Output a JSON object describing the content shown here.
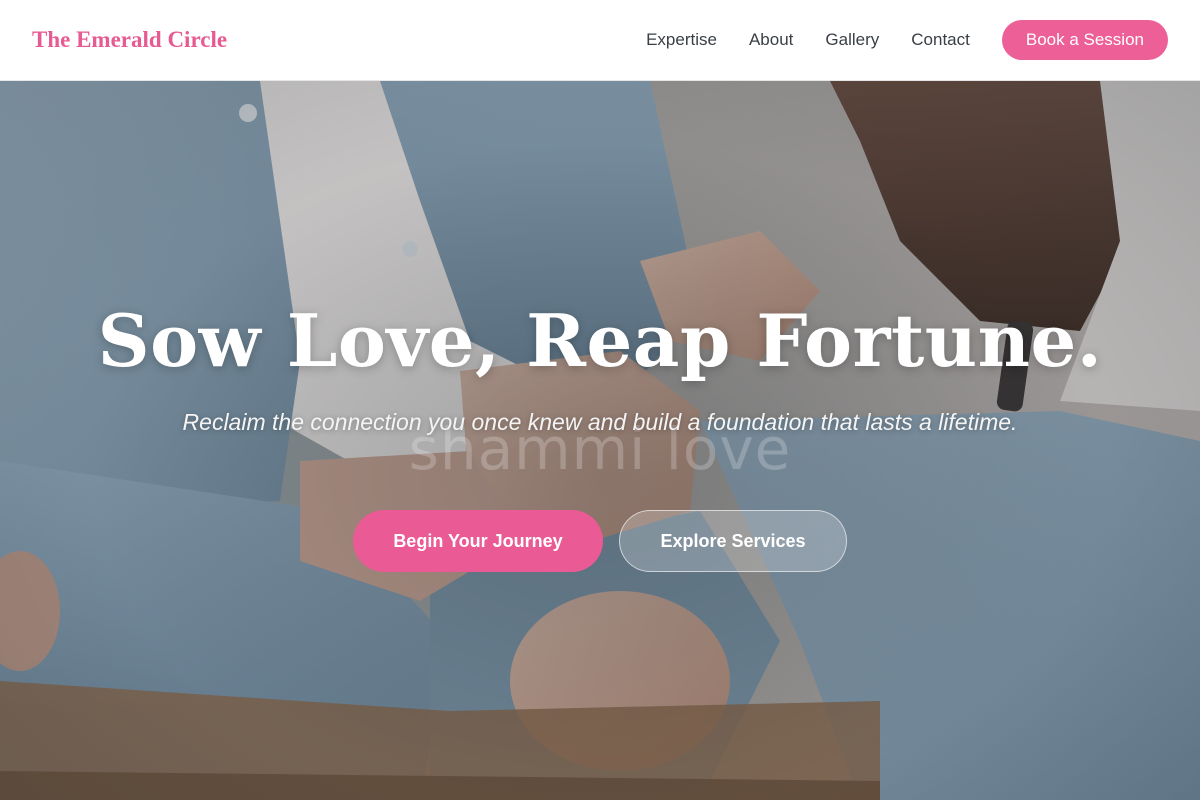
{
  "header": {
    "brand": "The Emerald Circle",
    "nav": [
      "Expertise",
      "About",
      "Gallery",
      "Contact"
    ],
    "cta": "Book a Session"
  },
  "hero": {
    "headline": "Sow Love, Reap Fortune.",
    "subheadline": "Reclaim the connection you once knew and build a foundation that lasts a lifetime.",
    "watermark": "shammi love",
    "primary_button": "Begin Your Journey",
    "secondary_button": "Explore Services"
  },
  "colors": {
    "brand_pink": "#e75b93",
    "button_pink": "#ea5a95",
    "nav_text": "#3a3f45"
  }
}
